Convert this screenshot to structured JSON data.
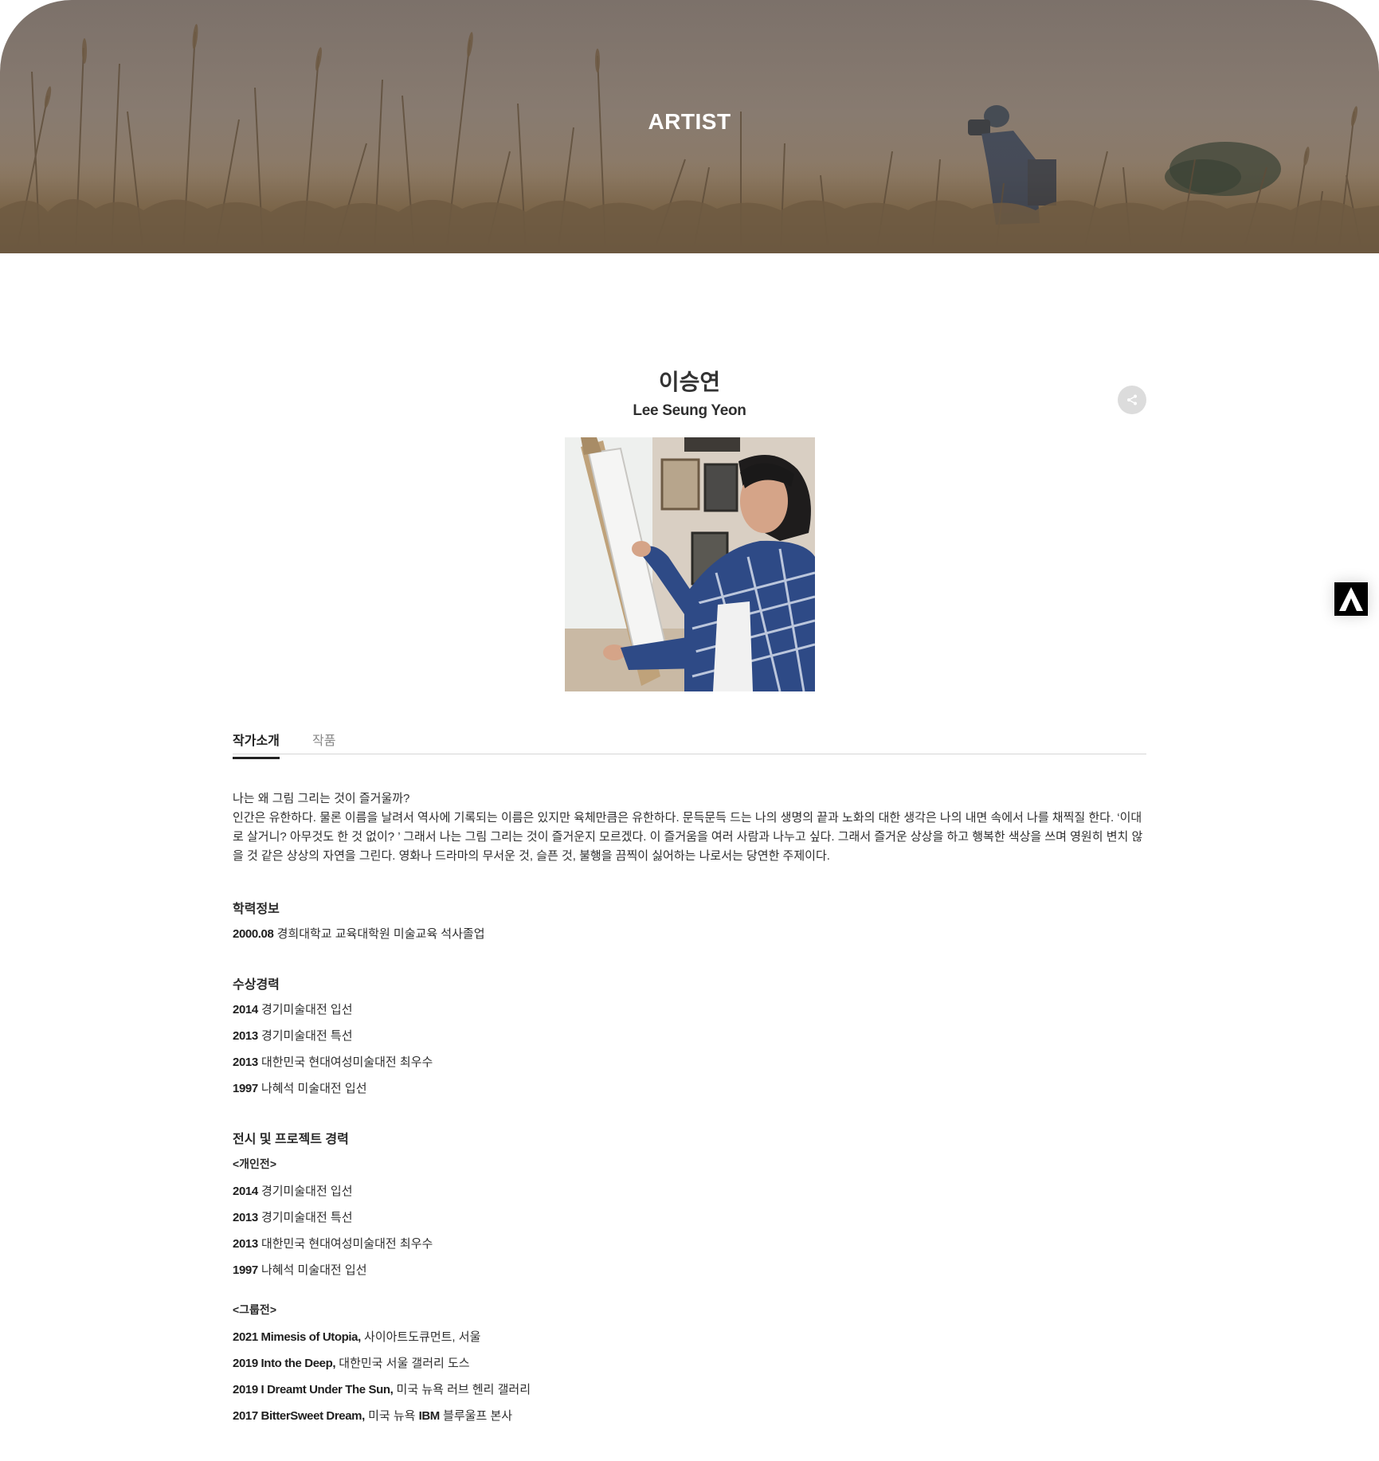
{
  "hero": {
    "title": "ARTIST"
  },
  "artist": {
    "name_ko": "이승연",
    "name_en": "Lee Seung Yeon"
  },
  "icons": {
    "share": "share-icon",
    "scroll_top": "arrow-up-icon"
  },
  "tabs": [
    {
      "label": "작가소개",
      "active": true
    },
    {
      "label": "작품",
      "active": false
    }
  ],
  "intro": {
    "question": "나는 왜 그림 그리는 것이 즐거울까?",
    "body": "인간은 유한하다. 물론 이름을 날려서 역사에 기록되는 이름은 있지만 육체만큼은 유한하다. 문득문득 드는 나의 생명의 끝과 노화의 대한 생각은 나의 내면 속에서 나를 채찍질 한다. ‘이대로 살거니? 아무것도 한 것 없이? ’ 그래서 나는 그림 그리는 것이 즐거운지 모르겠다. 이 즐거움을 여러 사람과 나누고 싶다. 그래서 즐거운 상상을 하고 행복한 색상을 쓰며 영원히 변치 않을 것 같은 상상의 자연을 그린다. 영화나 드라마의 무서운 것, 슬픈 것, 불행을 끔찍이 싫어하는 나로서는 당연한 주제이다."
  },
  "education": {
    "title": "학력정보",
    "items": [
      {
        "year": "2000.08",
        "text": "경희대학교 교육대학원 미술교육 석사졸업"
      }
    ]
  },
  "awards": {
    "title": "수상경력",
    "items": [
      {
        "year": "2014",
        "text": "경기미술대전 입선"
      },
      {
        "year": "2013",
        "text": "경기미술대전 특선"
      },
      {
        "year": "2013",
        "text": "대한민국 현대여성미술대전 최우수"
      },
      {
        "year": "1997",
        "text": "나혜석 미술대전 입선"
      }
    ]
  },
  "exhibitions": {
    "title": "전시 및 프로젝트 경력",
    "solo_label": "<개인전>",
    "solo": [
      {
        "year": "2014",
        "text": "경기미술대전 입선"
      },
      {
        "year": "2013",
        "text": "경기미술대전 특선"
      },
      {
        "year": "2013",
        "text": "대한민국 현대여성미술대전 최우수"
      },
      {
        "year": "1997",
        "text": "나혜석 미술대전 입선"
      }
    ],
    "group_label": "<그룹전>",
    "group": [
      {
        "bold": "2021 Mimesis of Utopia,",
        "text": "사이아트도큐먼트, 서울",
        "bold2": "",
        "text2": ""
      },
      {
        "bold": "2019 Into the Deep,",
        "text": "대한민국 서울 갤러리 도스",
        "bold2": "",
        "text2": ""
      },
      {
        "bold": "2019 I Dreamt Under The Sun,",
        "text": "미국 뉴욕 러브 헨리 갤러리",
        "bold2": "",
        "text2": ""
      },
      {
        "bold": "2017 BitterSweet Dream,",
        "text": "미국 뉴욕",
        "bold2": "IBM",
        "text2": "블루울프 본사"
      }
    ]
  }
}
